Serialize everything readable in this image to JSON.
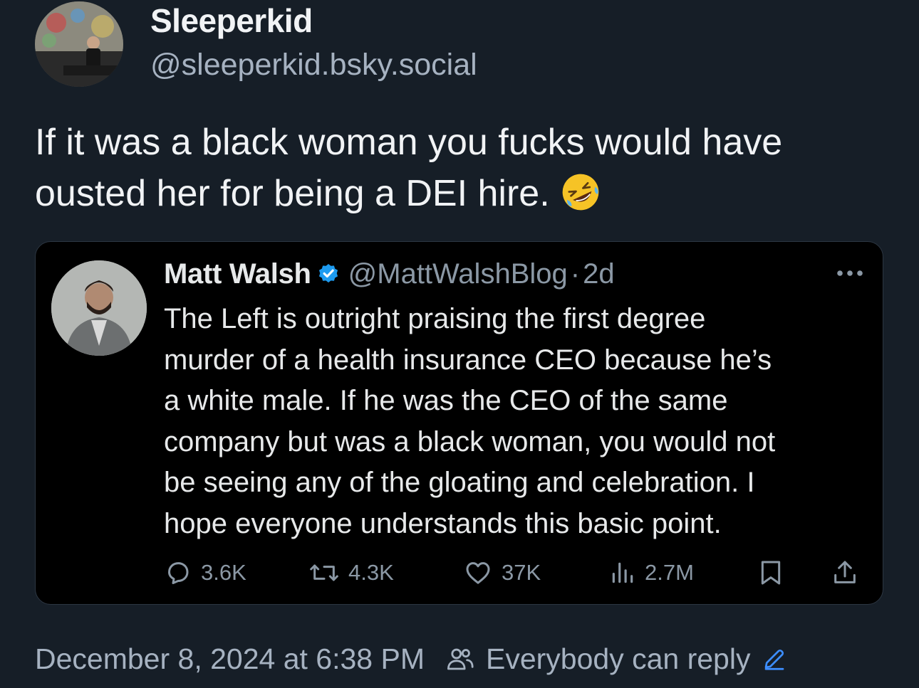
{
  "post": {
    "author": {
      "display_name": "Sleeperkid",
      "handle": "@sleeperkid.bsky.social",
      "avatar_icon": "avatar-photo"
    },
    "text_lines": [
      "If it was a black woman you fucks would have",
      "ousted her for being a DEI hire."
    ],
    "emoji": "rolling-on-the-floor-laughing-emoji",
    "timestamp": "December 8, 2024 at 6:38 PM",
    "reply_setting": "Everybody can reply"
  },
  "quote": {
    "display_name": "Matt Walsh",
    "verified": true,
    "handle": "@MattWalshBlog",
    "separator": "·",
    "time": "2d",
    "text_lines": [
      "The Left is outright praising the first degree",
      "murder of a health insurance CEO because he’s",
      "a white male. If he was the CEO of the same",
      "company but was a black woman, you would not",
      "be seeing any of the gloating and celebration. I",
      "hope everyone understands this basic point."
    ],
    "stats": {
      "replies": "3.6K",
      "reposts": "4.3K",
      "likes": "37K",
      "views": "2.7M"
    }
  },
  "colors": {
    "background": "#161e27",
    "quote_background": "#000000",
    "primary_text": "#f1f3f5",
    "secondary_text": "#a6b2c1",
    "verified_blue": "#1d9bf0",
    "edit_icon": "#3d8eff"
  }
}
